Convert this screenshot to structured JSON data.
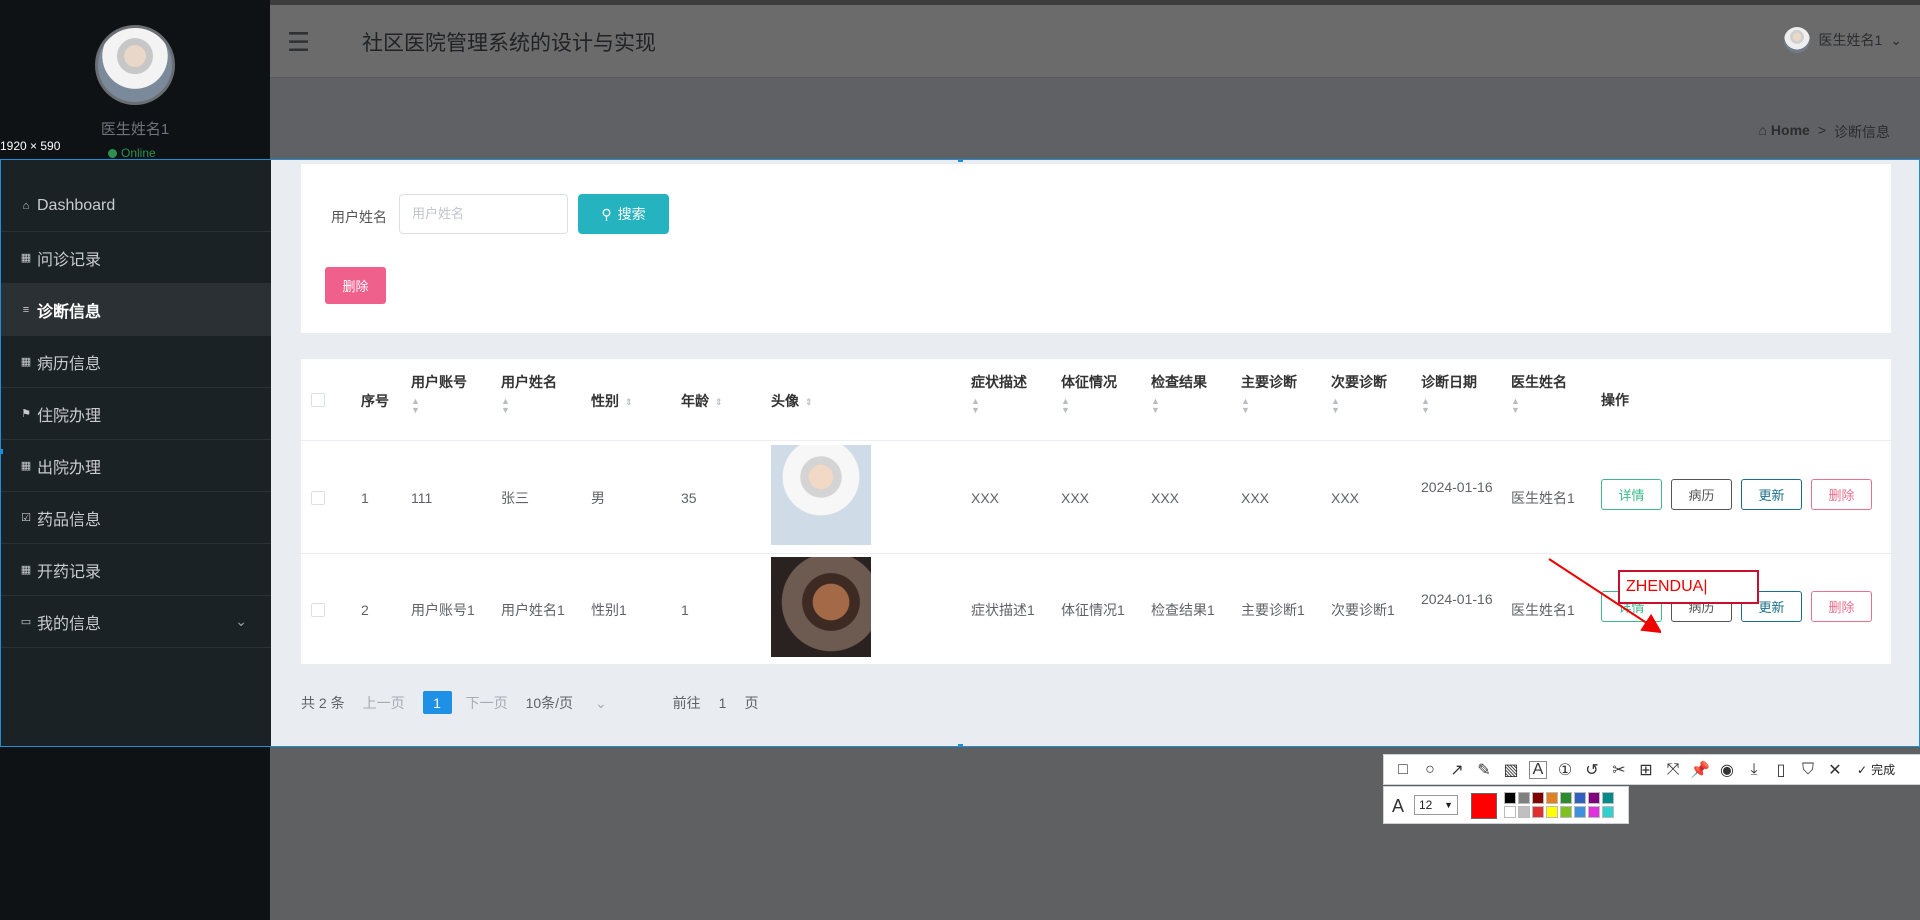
{
  "sidebar": {
    "doctor_name": "医生姓名1",
    "status": "Online",
    "items": [
      {
        "label": "Dashboard",
        "icon": "home-icon"
      },
      {
        "label": "问诊记录",
        "icon": "grid-icon"
      },
      {
        "label": "诊断信息",
        "icon": "list-icon"
      },
      {
        "label": "病历信息",
        "icon": "grid-icon"
      },
      {
        "label": "住院办理",
        "icon": "flag-icon"
      },
      {
        "label": "出院办理",
        "icon": "grid-icon"
      },
      {
        "label": "药品信息",
        "icon": "checkbox-icon"
      },
      {
        "label": "开药记录",
        "icon": "grid-icon"
      },
      {
        "label": "我的信息",
        "icon": "card-icon"
      }
    ]
  },
  "header": {
    "title": "社区医院管理系统的设计与实现",
    "user": "医生姓名1"
  },
  "breadcrumb": {
    "home": "Home",
    "sep": ">",
    "current": "诊断信息"
  },
  "selection": {
    "size_label": "1920 × 590"
  },
  "search": {
    "label": "用户姓名",
    "placeholder": "用户姓名",
    "button": "搜索",
    "delete_button": "删除"
  },
  "table": {
    "headers": [
      "序号",
      "用户账号",
      "用户姓名",
      "性别",
      "年龄",
      "头像",
      "症状描述",
      "体征情况",
      "检查结果",
      "主要诊断",
      "次要诊断",
      "诊断日期",
      "医生姓名",
      "操作"
    ],
    "rows": [
      {
        "no": "1",
        "account": "111",
        "name": "张三",
        "gender": "男",
        "age": "35",
        "symptom": "XXX",
        "sign": "XXX",
        "exam": "XXX",
        "main": "XXX",
        "secondary": "XXX",
        "date": "2024-01-16",
        "doctor": "医生姓名1"
      },
      {
        "no": "2",
        "account": "用户账号1",
        "name": "用户姓名1",
        "gender": "性别1",
        "age": "1",
        "symptom": "症状描述1",
        "sign": "体征情况1",
        "exam": "检查结果1",
        "main": "主要诊断1",
        "secondary": "次要诊断1",
        "date": "2024-01-16",
        "doctor": "医生姓名1"
      }
    ],
    "actions": {
      "detail": "详情",
      "record": "病历",
      "update": "更新",
      "remove": "删除"
    }
  },
  "pagination": {
    "total": "共 2 条",
    "prev": "上一页",
    "page": "1",
    "next": "下一页",
    "size": "10条/页",
    "goto": "前往",
    "goto_page": "1",
    "unit": "页"
  },
  "annotation": {
    "text": "ZHENDUA",
    "color": "#e00000"
  },
  "screenshot_tool": {
    "done": "完成",
    "font_size": "12",
    "current_color": "#ff0000",
    "palette": [
      "#000000",
      "#808080",
      "#800000",
      "#e08020",
      "#2e8b2e",
      "#3060c0",
      "#800080",
      "#008b8b",
      "#ffffff",
      "#c0c0c0",
      "#e03030",
      "#ffff00",
      "#80c020",
      "#4090e0",
      "#e030e0",
      "#30d0d0"
    ]
  }
}
